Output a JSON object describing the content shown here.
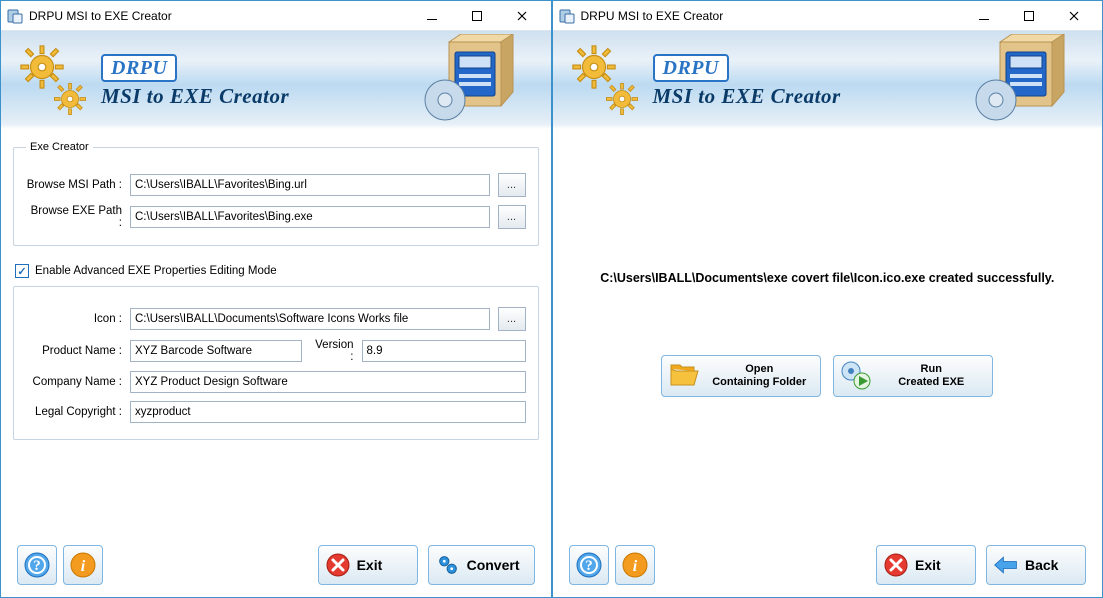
{
  "left": {
    "title": "DRPU MSI to EXE Creator",
    "brand": "DRPU",
    "subtitle": "MSI to EXE Creator",
    "group1_legend": "Exe Creator",
    "msi_label": "Browse MSI Path :",
    "msi_value": "C:\\Users\\IBALL\\Favorites\\Bing.url",
    "exe_label": "Browse EXE Path :",
    "exe_value": "C:\\Users\\IBALL\\Favorites\\Bing.exe",
    "ellipsis": "...",
    "adv_label": "Enable Advanced EXE Properties Editing Mode",
    "icon_label": "Icon :",
    "icon_value": "C:\\Users\\IBALL\\Documents\\Software Icons Works file",
    "product_label": "Product Name :",
    "product_value": "XYZ Barcode Software",
    "version_label": "Version :",
    "version_value": "8.9",
    "company_label": "Company Name :",
    "company_value": "XYZ Product Design Software",
    "copyright_label": "Legal Copyright :",
    "copyright_value": "xyzproduct",
    "exit": "Exit",
    "convert": "Convert"
  },
  "right": {
    "title": "DRPU MSI to EXE Creator",
    "brand": "DRPU",
    "subtitle": "MSI to EXE Creator",
    "status": "C:\\Users\\IBALL\\Documents\\exe covert file\\Icon.ico.exe created successfully.",
    "open1": "Open",
    "open2": "Containing Folder",
    "run1": "Run",
    "run2": "Created EXE",
    "exit": "Exit",
    "back": "Back"
  }
}
